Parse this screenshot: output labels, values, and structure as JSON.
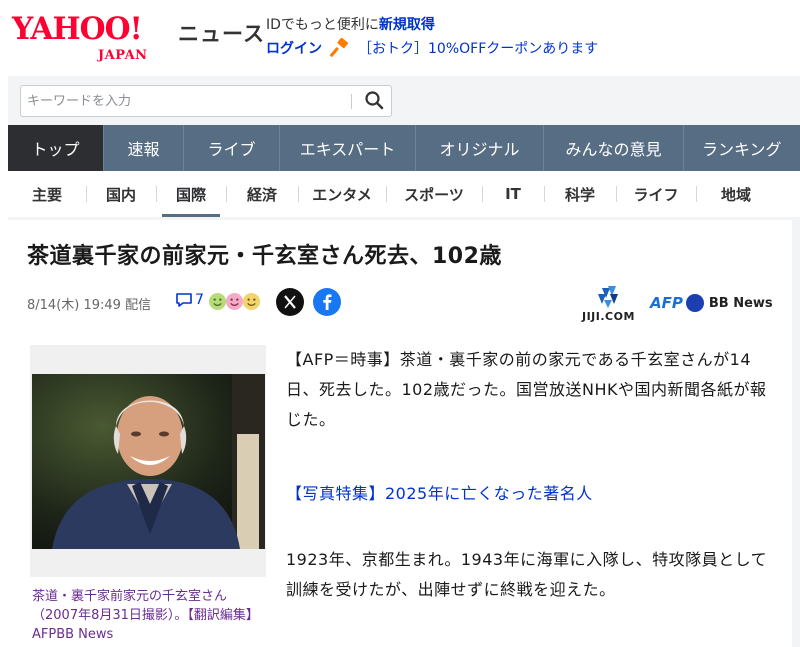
{
  "header": {
    "logo_main": "YAHOO!",
    "logo_sub": "JAPAN",
    "service_name": "ニュース",
    "promo_line1_text": "IDでもっと便利に",
    "promo_line1_link": "新規取得",
    "login_label": "ログイン",
    "promo_line2_text": "［おトク］10%OFFクーポンあります"
  },
  "search": {
    "placeholder": "キーワードを入力"
  },
  "nav_primary": [
    {
      "label": "トップ",
      "active": true
    },
    {
      "label": "速報"
    },
    {
      "label": "ライブ"
    },
    {
      "label": "エキスパート"
    },
    {
      "label": "オリジナル"
    },
    {
      "label": "みんなの意見"
    },
    {
      "label": "ランキング"
    }
  ],
  "nav_secondary": [
    {
      "label": "主要"
    },
    {
      "label": "国内"
    },
    {
      "label": "国際",
      "active": true
    },
    {
      "label": "経済"
    },
    {
      "label": "エンタメ"
    },
    {
      "label": "スポーツ"
    },
    {
      "label": "IT"
    },
    {
      "label": "科学"
    },
    {
      "label": "ライフ"
    },
    {
      "label": "地域"
    }
  ],
  "article": {
    "headline": "茶道裏千家の前家元・千玄室さん死去、102歳",
    "meta": "8/14(木) 19:49 配信",
    "comment_count": "7",
    "publishers": {
      "jiji": "JIJI.COM",
      "afp": "AFP",
      "bb": "BB News"
    },
    "caption": "茶道・裏千家前家元の千玄室さん（2007年8月31日撮影）。【翻訳編集】 AFPBB News",
    "paragraph1": "【AFP＝時事】茶道・裏千家の前の家元である千玄室さんが14日、死去した。102歳だった。国営放送NHKや国内新聞各紙が報じた。",
    "related_link": "【写真特集】2025年に亡くなった著名人",
    "paragraph3": "1923年、京都生まれ。1943年に海軍に入隊し、特攻隊員として訓練を受けたが、出陣せずに終戦を迎えた。"
  },
  "colors": {
    "brand_red": "#ff0033",
    "nav_bg": "#566d83",
    "nav_active": "#2d2e31",
    "link_blue": "#0033cc",
    "caption_purple": "#6b2c91"
  }
}
